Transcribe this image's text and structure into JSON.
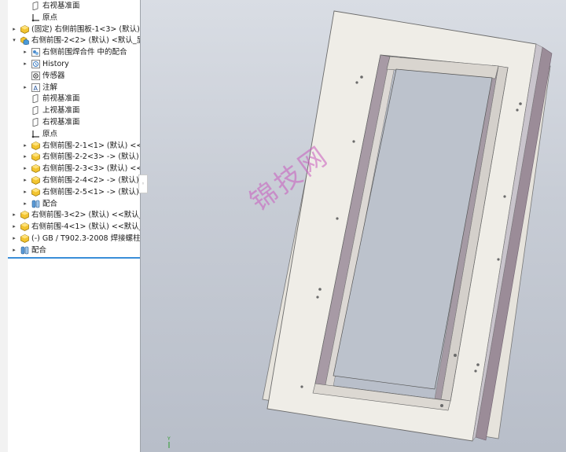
{
  "tree": {
    "rows": [
      {
        "label": "右视基准面",
        "icon": "plane-icon",
        "caret": "",
        "indent": 1
      },
      {
        "label": "原点",
        "icon": "origin-icon",
        "caret": "",
        "indent": 1
      },
      {
        "label": "(固定) 右侧前围板-1<3> (默认) <",
        "icon": "part-icon",
        "caret": "▸",
        "indent": 0
      },
      {
        "label": "右侧前围-2<2> (默认) <默认_显",
        "icon": "assembly-icon",
        "caret": "▾",
        "indent": 0
      },
      {
        "label": "右侧前围焊合件 中的配合",
        "icon": "mates-folder-icon",
        "caret": "▸",
        "indent": 1
      },
      {
        "label": "History",
        "icon": "history-icon",
        "caret": "▸",
        "indent": 1
      },
      {
        "label": "传感器",
        "icon": "sensor-icon",
        "caret": "",
        "indent": 1
      },
      {
        "label": "注解",
        "icon": "annotation-icon",
        "caret": "▸",
        "indent": 1
      },
      {
        "label": "前视基准面",
        "icon": "plane-icon",
        "caret": "",
        "indent": 1
      },
      {
        "label": "上视基准面",
        "icon": "plane-icon",
        "caret": "",
        "indent": 1
      },
      {
        "label": "右视基准面",
        "icon": "plane-icon",
        "caret": "",
        "indent": 1
      },
      {
        "label": "原点",
        "icon": "origin-icon",
        "caret": "",
        "indent": 1
      },
      {
        "label": "右侧前围-2-1<1> (默认) <<默",
        "icon": "part-icon",
        "caret": "▸",
        "indent": 1
      },
      {
        "label": "右侧前围-2-2<3> -> (默认) <",
        "icon": "part-icon",
        "caret": "▸",
        "indent": 1
      },
      {
        "label": "右侧前围-2-3<3> (默认) <<默",
        "icon": "part-icon",
        "caret": "▸",
        "indent": 1
      },
      {
        "label": "右侧前围-2-4<2> -> (默认) <",
        "icon": "part-icon",
        "caret": "▸",
        "indent": 1
      },
      {
        "label": "右侧前围-2-5<1> -> (默认) <",
        "icon": "part-icon",
        "caret": "▸",
        "indent": 1
      },
      {
        "label": "配合",
        "icon": "mates-icon",
        "caret": "▸",
        "indent": 1
      },
      {
        "label": "右侧前围-3<2> (默认) <<默认_",
        "icon": "part-icon",
        "caret": "▸",
        "indent": 0
      },
      {
        "label": "右侧前围-4<1> (默认) <<默认_",
        "icon": "part-icon",
        "caret": "▸",
        "indent": 0
      },
      {
        "label": "(-) GB / T902.3-2008 焊接螺柱M",
        "icon": "part-icon",
        "caret": "▸",
        "indent": 0
      },
      {
        "label": "配合",
        "icon": "mates-icon",
        "caret": "▸",
        "indent": 0
      }
    ]
  },
  "viewport": {
    "watermark": "锦技网",
    "axis_label": "Y"
  },
  "colors": {
    "panel": "#f2f2ee",
    "viewport_top": "#d9dde4",
    "accent": "#3a8ed8"
  }
}
